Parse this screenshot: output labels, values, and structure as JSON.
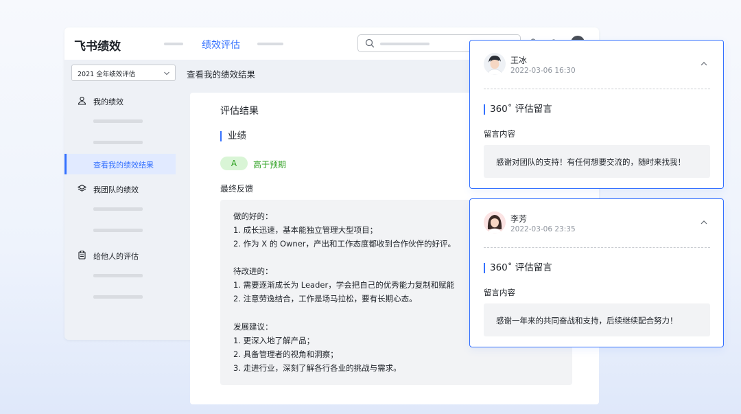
{
  "app": {
    "brand": "飞书绩效",
    "active_nav": "绩效评估"
  },
  "sidebar": {
    "period": "2021 全年绩效评估",
    "groups": [
      {
        "label": "我的绩效",
        "icon": "user-icon"
      },
      {
        "label": "我团队的绩效",
        "icon": "layers-icon"
      },
      {
        "label": "给他人的评估",
        "icon": "clipboard-icon"
      }
    ],
    "active_item": "查看我的绩效结果"
  },
  "breadcrumb": "查看我的绩效结果",
  "result": {
    "title": "评估结果",
    "section": "业绩",
    "grade": "A",
    "grade_text": "高于预期",
    "feedback_title": "最终反馈",
    "feedback_lines": [
      "做的好的：",
      "1. 成长迅速，基本能独立管理大型项目；",
      "2. 作为 X 的 Owner，产出和工作态度都收到合作伙伴的好评。",
      "",
      "待改进的：",
      "1. 需要逐渐成长为 Leader，学会把自己的优秀能力复制和赋能",
      "2. 注意劳逸结合，工作是场马拉松，要有长期心态。",
      "",
      "发展建议：",
      "1. 更深入地了解产品；",
      "2. 具备管理者的视角和洞察；",
      "3. 走进行业，深刻了解各行各业的挑战与需求。"
    ]
  },
  "comments": [
    {
      "name": "王冰",
      "time": "2022-03-06 16:30",
      "section": "360˚ 评估留言",
      "label": "留言内容",
      "message": "感谢对团队的支持！有任何想要交流的，随时来找我！"
    },
    {
      "name": "李芳",
      "time": "2022-03-06 23:35",
      "section": "360˚ 评估留言",
      "label": "留言内容",
      "message": "感谢一年来的共同奋战和支持，后续继续配合努力！"
    }
  ],
  "colors": {
    "accent": "#3370ff",
    "grade_green": "#2ea121",
    "grade_bg": "#d9f5d6"
  }
}
